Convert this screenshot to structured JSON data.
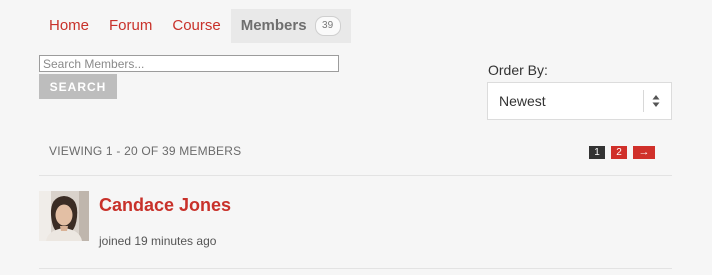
{
  "tabs": [
    {
      "label": "Home"
    },
    {
      "label": "Forum"
    },
    {
      "label": "Course"
    },
    {
      "label": "Members",
      "count": "39",
      "active": true
    }
  ],
  "search": {
    "placeholder": "Search Members...",
    "value": "",
    "button_label": "SEARCH"
  },
  "order_by": {
    "label": "Order By:",
    "selected": "Newest"
  },
  "listing": {
    "viewing_text": "VIEWING 1 - 20 OF 39 MEMBERS",
    "pagination": {
      "current": "1",
      "next_page": "2",
      "next_arrow": "→"
    }
  },
  "members": [
    {
      "name": "Candace Jones",
      "meta": "joined 19 minutes ago"
    }
  ],
  "colors": {
    "accent": "#c8312a",
    "background": "#f6f6f6",
    "active_tab_bg": "#e9e9e9",
    "search_button_bg": "#bdbdbd",
    "current_page_bg": "#333333"
  }
}
